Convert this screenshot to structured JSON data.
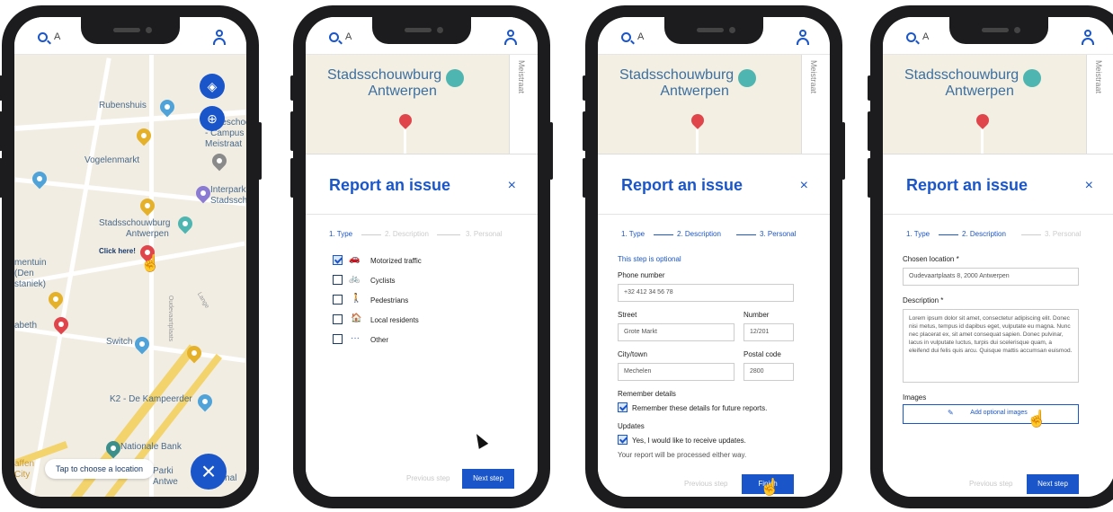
{
  "colors": {
    "accent": "#1a56c9",
    "map_bg": "#f1ede3",
    "road_yellow": "#f3d36b",
    "pin_red": "#e0454c",
    "pin_teal": "#4fb5b0"
  },
  "common": {
    "search_text": "A",
    "user_icon": "user-icon",
    "map_venue_line1": "Stadsschouwburg",
    "map_venue_line2": "Antwerpen",
    "map_street": "Meistraat"
  },
  "phone1": {
    "labels": {
      "rubenshuis": "Rubenshuis",
      "hogeschool": "Hogeschool",
      "campus": "- Campus",
      "meistraat": "Meistraat",
      "vogelenmarkt": "Vogelenmarkt",
      "interpark": "Interpark",
      "stadssch": "Stadssch",
      "stadsschouwburg": "Stadsschouwburg",
      "antwerpen": "Antwerpen",
      "click_here": "Click here!",
      "mentuin": "mentuin",
      "den": "(Den",
      "staniek": "staniek)",
      "abeth": "abeth",
      "switch": "Switch",
      "k2": "K2 - De Kampeerder",
      "nationale_bank": "Nationale Bank",
      "parki": "Parki",
      "antw": "Antwe",
      "ational": "ational",
      "affe": "affen",
      "city": "City",
      "oudevaart": "Oudevaartplaats",
      "lange": "Lange"
    },
    "chip_label": "Tap to choose a location",
    "close_fab": "×"
  },
  "phone2": {
    "title": "Report an issue",
    "close": "×",
    "steps": [
      "1. Type",
      "2. Description",
      "3. Personal"
    ],
    "options": [
      {
        "label": "Motorized traffic",
        "icon": "car-icon",
        "glyph": "🚗",
        "checked": true
      },
      {
        "label": "Cyclists",
        "icon": "bicycle-icon",
        "glyph": "🚲",
        "checked": false
      },
      {
        "label": "Pedestrians",
        "icon": "pedestrian-icon",
        "glyph": "🚶",
        "checked": false
      },
      {
        "label": "Local residents",
        "icon": "house-icon",
        "glyph": "🏠",
        "checked": false
      },
      {
        "label": "Other",
        "icon": "dots-icon",
        "glyph": "···",
        "checked": false
      }
    ],
    "prev_button": "Previous step",
    "next_button": "Next step"
  },
  "phone3": {
    "title": "Report an issue",
    "close": "×",
    "steps": [
      "1. Type",
      "2. Description",
      "3. Personal"
    ],
    "optional_note": "This step is optional",
    "phone_label": "Phone number",
    "phone_value": "+32 412 34 56 78",
    "street_label": "Street",
    "street_value": "Grote Markt",
    "number_label": "Number",
    "number_value": "12/201",
    "city_label": "City/town",
    "city_value": "Mechelen",
    "postal_label": "Postal code",
    "postal_value": "2800",
    "remember_heading": "Remember details",
    "remember_label": "Remember these details for future reports.",
    "updates_heading": "Updates",
    "updates_label": "Yes, I would like to receive updates.",
    "updates_note": "Your report will be processed either way.",
    "prev_button": "Previous step",
    "finish_button": "Finish"
  },
  "phone4": {
    "title": "Report an issue",
    "close": "×",
    "steps": [
      "1. Type",
      "2. Description",
      "3. Personal"
    ],
    "location_label": "Chosen location *",
    "location_value": "Oudevaartplaats 8, 2000 Antwerpen",
    "description_label": "Description *",
    "description_value": "Lorem ipsum dolor sit amet, consectetur adipiscing elit. Donec nisi metus, tempus id dapibus eget, vulputate eu magna. Nunc nec placerat ex, sit amet consequat sapien. Donec pulvinar, lacus in vulputate luctus, turpis dui scelerisque quam, a eleifend dui felis quis arcu. Quisque mattis accumsan euismod.",
    "images_label": "Images",
    "add_images_button": "Add optional images",
    "prev_button": "Previous step",
    "next_button": "Next step"
  }
}
